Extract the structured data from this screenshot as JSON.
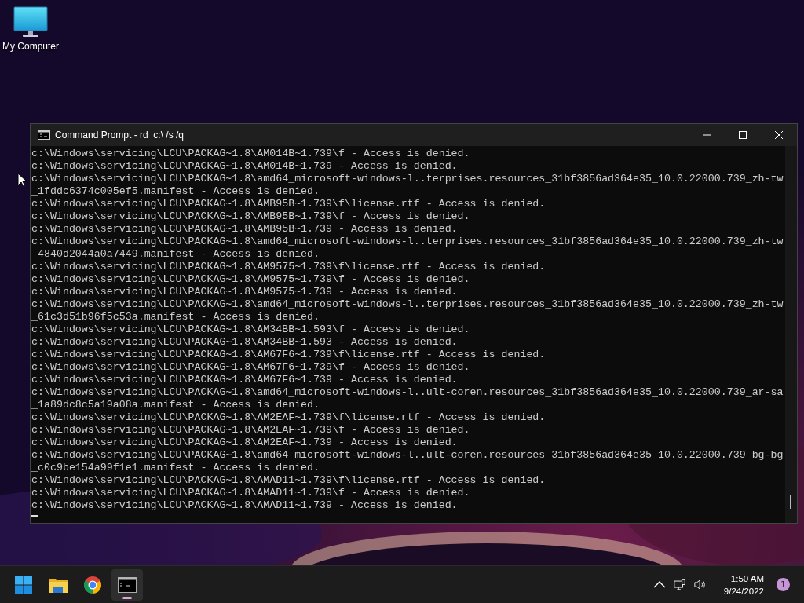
{
  "desktop": {
    "icons": [
      {
        "kind": "computer",
        "label": "My Computer"
      }
    ]
  },
  "window": {
    "title": "Command Prompt - rd  c:\\ /s /q",
    "lines": [
      "c:\\Windows\\servicing\\LCU\\PACKAG~1.8\\AM014B~1.739\\f - Access is denied.",
      "c:\\Windows\\servicing\\LCU\\PACKAG~1.8\\AM014B~1.739 - Access is denied.",
      "c:\\Windows\\servicing\\LCU\\PACKAG~1.8\\amd64_microsoft-windows-l..terprises.resources_31bf3856ad364e35_10.0.22000.739_zh-tw",
      "_1fddc6374c005ef5.manifest - Access is denied.",
      "c:\\Windows\\servicing\\LCU\\PACKAG~1.8\\AMB95B~1.739\\f\\license.rtf - Access is denied.",
      "c:\\Windows\\servicing\\LCU\\PACKAG~1.8\\AMB95B~1.739\\f - Access is denied.",
      "c:\\Windows\\servicing\\LCU\\PACKAG~1.8\\AMB95B~1.739 - Access is denied.",
      "c:\\Windows\\servicing\\LCU\\PACKAG~1.8\\amd64_microsoft-windows-l..terprises.resources_31bf3856ad364e35_10.0.22000.739_zh-tw",
      "_4840d2044a0a7449.manifest - Access is denied.",
      "c:\\Windows\\servicing\\LCU\\PACKAG~1.8\\AM9575~1.739\\f\\license.rtf - Access is denied.",
      "c:\\Windows\\servicing\\LCU\\PACKAG~1.8\\AM9575~1.739\\f - Access is denied.",
      "c:\\Windows\\servicing\\LCU\\PACKAG~1.8\\AM9575~1.739 - Access is denied.",
      "c:\\Windows\\servicing\\LCU\\PACKAG~1.8\\amd64_microsoft-windows-l..terprises.resources_31bf3856ad364e35_10.0.22000.739_zh-tw",
      "_61c3d51b96f5c53a.manifest - Access is denied.",
      "c:\\Windows\\servicing\\LCU\\PACKAG~1.8\\AM34BB~1.593\\f - Access is denied.",
      "c:\\Windows\\servicing\\LCU\\PACKAG~1.8\\AM34BB~1.593 - Access is denied.",
      "c:\\Windows\\servicing\\LCU\\PACKAG~1.8\\AM67F6~1.739\\f\\license.rtf - Access is denied.",
      "c:\\Windows\\servicing\\LCU\\PACKAG~1.8\\AM67F6~1.739\\f - Access is denied.",
      "c:\\Windows\\servicing\\LCU\\PACKAG~1.8\\AM67F6~1.739 - Access is denied.",
      "c:\\Windows\\servicing\\LCU\\PACKAG~1.8\\amd64_microsoft-windows-l..ult-coren.resources_31bf3856ad364e35_10.0.22000.739_ar-sa",
      "_1a89dc8c5a19a08a.manifest - Access is denied.",
      "c:\\Windows\\servicing\\LCU\\PACKAG~1.8\\AM2EAF~1.739\\f\\license.rtf - Access is denied.",
      "c:\\Windows\\servicing\\LCU\\PACKAG~1.8\\AM2EAF~1.739\\f - Access is denied.",
      "c:\\Windows\\servicing\\LCU\\PACKAG~1.8\\AM2EAF~1.739 - Access is denied.",
      "c:\\Windows\\servicing\\LCU\\PACKAG~1.8\\amd64_microsoft-windows-l..ult-coren.resources_31bf3856ad364e35_10.0.22000.739_bg-bg",
      "_c0c9be154a99f1e1.manifest - Access is denied.",
      "c:\\Windows\\servicing\\LCU\\PACKAG~1.8\\AMAD11~1.739\\f\\license.rtf - Access is denied.",
      "c:\\Windows\\servicing\\LCU\\PACKAG~1.8\\AMAD11~1.739\\f - Access is denied.",
      "c:\\Windows\\servicing\\LCU\\PACKAG~1.8\\AMAD11~1.739 - Access is denied."
    ]
  },
  "taskbar": {
    "apps": [
      {
        "kind": "start",
        "selected": false
      },
      {
        "kind": "folder",
        "selected": false
      },
      {
        "kind": "browser",
        "selected": false
      },
      {
        "kind": "terminal",
        "selected": true
      }
    ],
    "tray": {
      "time": "1:50 AM",
      "date": "9/24/2022",
      "notification_count": "1"
    }
  }
}
